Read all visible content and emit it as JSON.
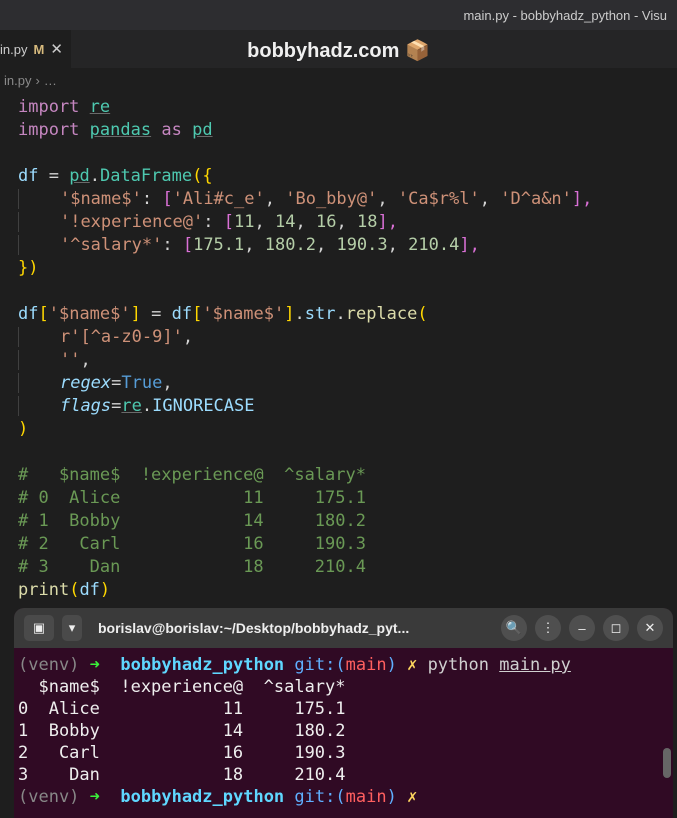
{
  "window": {
    "title": "main.py - bobbyhadz_python - Visu"
  },
  "tab": {
    "filename": "in.py",
    "modified_indicator": "M",
    "close": "✕"
  },
  "banner": {
    "text": "bobbyhadz.com",
    "icon": "📦"
  },
  "breadcrumb": {
    "file": "in.py",
    "sep": "›",
    "more": "…"
  },
  "code": {
    "l1": {
      "kw": "import",
      "mod": "re"
    },
    "l2": {
      "kw": "import",
      "mod": "pandas",
      "as": "as",
      "alias": "pd"
    },
    "l4": {
      "var": "df",
      "eq": "=",
      "obj": "pd",
      "dot": ".",
      "cls": "DataFrame",
      "open": "({"
    },
    "l5": {
      "key": "'$name$'",
      "colon": ":",
      "open": "[",
      "v1": "'Ali#c_e'",
      "v2": "'Bo_bby@'",
      "v3": "'Ca$r%l'",
      "v4": "'D^a&n'",
      "close": "],",
      "c": ","
    },
    "l6": {
      "key": "'!experience@'",
      "colon": ":",
      "open": "[",
      "v1": "11",
      "v2": "14",
      "v3": "16",
      "v4": "18",
      "close": "],",
      "c": ","
    },
    "l7": {
      "key": "'^salary*'",
      "colon": ":",
      "open": "[",
      "v1": "175.1",
      "v2": "180.2",
      "v3": "190.3",
      "v4": "210.4",
      "close": "],",
      "c": ","
    },
    "l8": {
      "close": "})"
    },
    "l10": {
      "var": "df",
      "open": "[",
      "key": "'$name$'",
      "close": "]",
      "eq": "=",
      "var2": "df",
      "open2": "[",
      "key2": "'$name$'",
      "close2": "]",
      "dot": ".",
      "attr": "str",
      "dot2": ".",
      "fn": "replace",
      "paren": "("
    },
    "l11": {
      "pre": "r",
      "str": "'[^a-z0-9]'",
      "c": ","
    },
    "l12": {
      "str": "''",
      "c": ","
    },
    "l13": {
      "param": "regex",
      "eq": "=",
      "val": "True",
      "c": ","
    },
    "l14": {
      "param": "flags",
      "eq": "=",
      "mod": "re",
      "dot": ".",
      "attr": "IGNORECASE"
    },
    "l15": {
      "close": ")"
    },
    "c1": "#   $name$  !experience@  ^salary*",
    "c2": "# 0  Alice            11     175.1",
    "c3": "# 1  Bobby            14     180.2",
    "c4": "# 2   Carl            16     190.3",
    "c5": "# 3    Dan            18     210.4",
    "l22": {
      "fn": "print",
      "open": "(",
      "var": "df",
      "close": ")"
    }
  },
  "terminal": {
    "titlebar": "borislav@borislav:~/Desktop/bobbyhadz_pyt...",
    "prompt": {
      "venv": "(venv)",
      "arrow": "➜",
      "dir": "bobbyhadz_python",
      "git_label": "git:(",
      "branch": "main",
      "git_close": ")",
      "dirty": "✗",
      "cmd": "python",
      "file": "main.py"
    },
    "out1": "  $name$  !experience@  ^salary*",
    "out2": "0  Alice            11     175.1",
    "out3": "1  Bobby            14     180.2",
    "out4": "2   Carl            16     190.3",
    "out5": "3    Dan            18     210.4"
  }
}
